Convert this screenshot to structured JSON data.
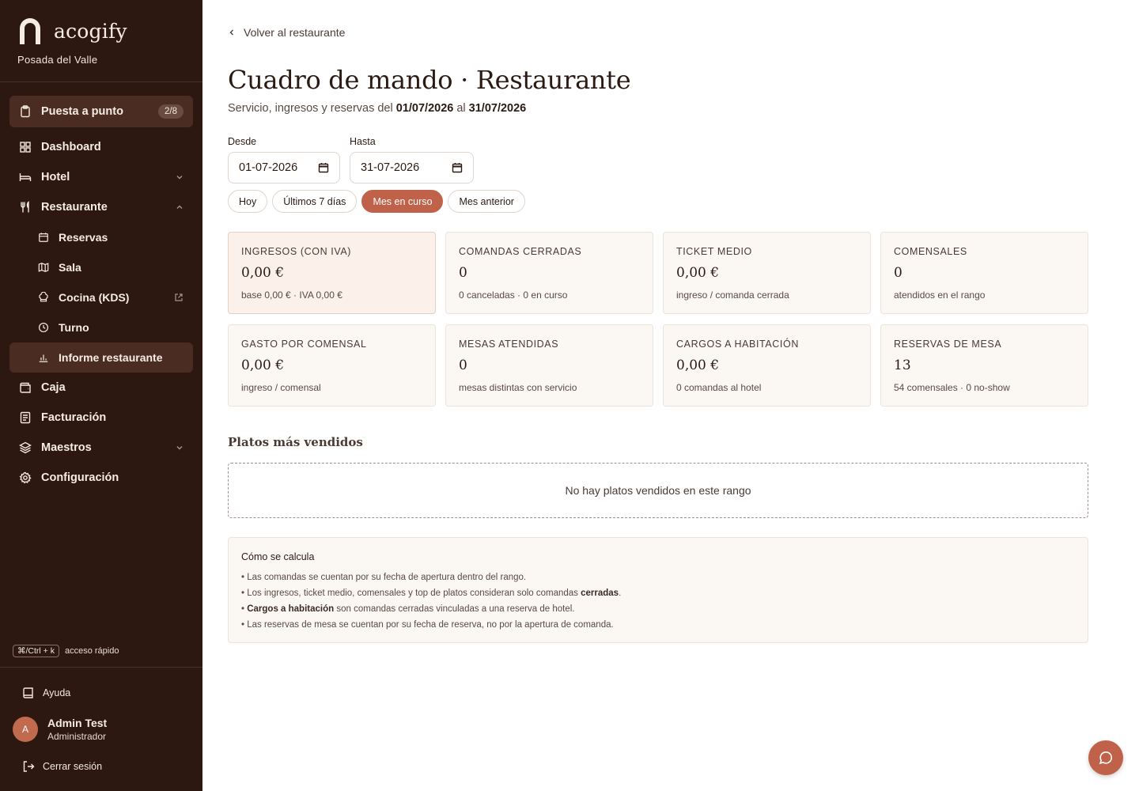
{
  "brand": {
    "name": "acogify",
    "property": "Posada del Valle"
  },
  "sidebar": {
    "setup": {
      "label": "Puesta a punto",
      "badge": "2/8"
    },
    "items": [
      {
        "label": "Dashboard",
        "icon": "grid-icon"
      },
      {
        "label": "Hotel",
        "icon": "bed-icon"
      },
      {
        "label": "Restaurante",
        "icon": "utensils-icon"
      },
      {
        "label": "Reservas",
        "icon": "calendar-icon"
      },
      {
        "label": "Sala",
        "icon": "map-icon"
      },
      {
        "label": "Cocina (KDS)",
        "icon": "chef-hat-icon"
      },
      {
        "label": "Turno",
        "icon": "clock-icon"
      },
      {
        "label": "Informe restaurante",
        "icon": "bar-chart-icon"
      },
      {
        "label": "Caja",
        "icon": "wallet-icon"
      },
      {
        "label": "Facturación",
        "icon": "file-icon"
      },
      {
        "label": "Maestros",
        "icon": "layers-icon"
      },
      {
        "label": "Configuración",
        "icon": "gear-icon"
      }
    ],
    "shortcut": {
      "keys": "⌘/Ctrl + k",
      "label": "acceso rápido"
    },
    "help": "Ayuda",
    "user": {
      "initial": "A",
      "name": "Admin Test",
      "role": "Administrador"
    },
    "logout": "Cerrar sesión"
  },
  "main": {
    "back": "Volver al restaurante",
    "title": "Cuadro de mando · Restaurante",
    "subtitle_prefix": "Servicio, ingresos y reservas del ",
    "date_from": "01/07/2026",
    "subtitle_mid": " al ",
    "date_to": "31/07/2026",
    "from_label": "Desde",
    "from_value": "01-07-2026",
    "to_label": "Hasta",
    "to_value": "31-07-2026",
    "presets": [
      "Hoy",
      "Últimos 7 días",
      "Mes en curso",
      "Mes anterior"
    ],
    "active_preset": "Mes en curso",
    "kpis": [
      {
        "label": "INGRESOS (CON IVA)",
        "value": "0,00 €",
        "sub": "base 0,00 € · IVA 0,00 €"
      },
      {
        "label": "COMANDAS CERRADAS",
        "value": "0",
        "sub": "0 canceladas · 0 en curso"
      },
      {
        "label": "TICKET MEDIO",
        "value": "0,00 €",
        "sub": "ingreso / comanda cerrada"
      },
      {
        "label": "COMENSALES",
        "value": "0",
        "sub": "atendidos en el rango"
      },
      {
        "label": "GASTO POR COMENSAL",
        "value": "0,00 €",
        "sub": "ingreso / comensal"
      },
      {
        "label": "MESAS ATENDIDAS",
        "value": "0",
        "sub": "mesas distintas con servicio"
      },
      {
        "label": "CARGOS A HABITACIÓN",
        "value": "0,00 €",
        "sub": "0 comandas al hotel"
      },
      {
        "label": "RESERVAS DE MESA",
        "value": "13",
        "sub": "54 comensales · 0 no-show"
      }
    ],
    "top_dishes_title": "Platos más vendidos",
    "top_dishes_empty": "No hay platos vendidos en este rango",
    "info": {
      "title": "Cómo se calcula",
      "line1": "• Las comandas se cuentan por su fecha de apertura dentro del rango.",
      "line2_a": "• Los ingresos, ticket medio, comensales y top de platos consideran solo comandas ",
      "line2_b": "cerradas",
      "line2_c": ".",
      "line3_a": "• ",
      "line3_b": "Cargos a habitación",
      "line3_c": " son comandas cerradas vinculadas a una reserva de hotel.",
      "line4": "• Las reservas de mesa se cuentan por su fecha de reserva, no por la apertura de comanda."
    }
  },
  "colors": {
    "sidebar": "#2c1811",
    "accent": "#c0624a",
    "card": "#fbf7f3"
  }
}
